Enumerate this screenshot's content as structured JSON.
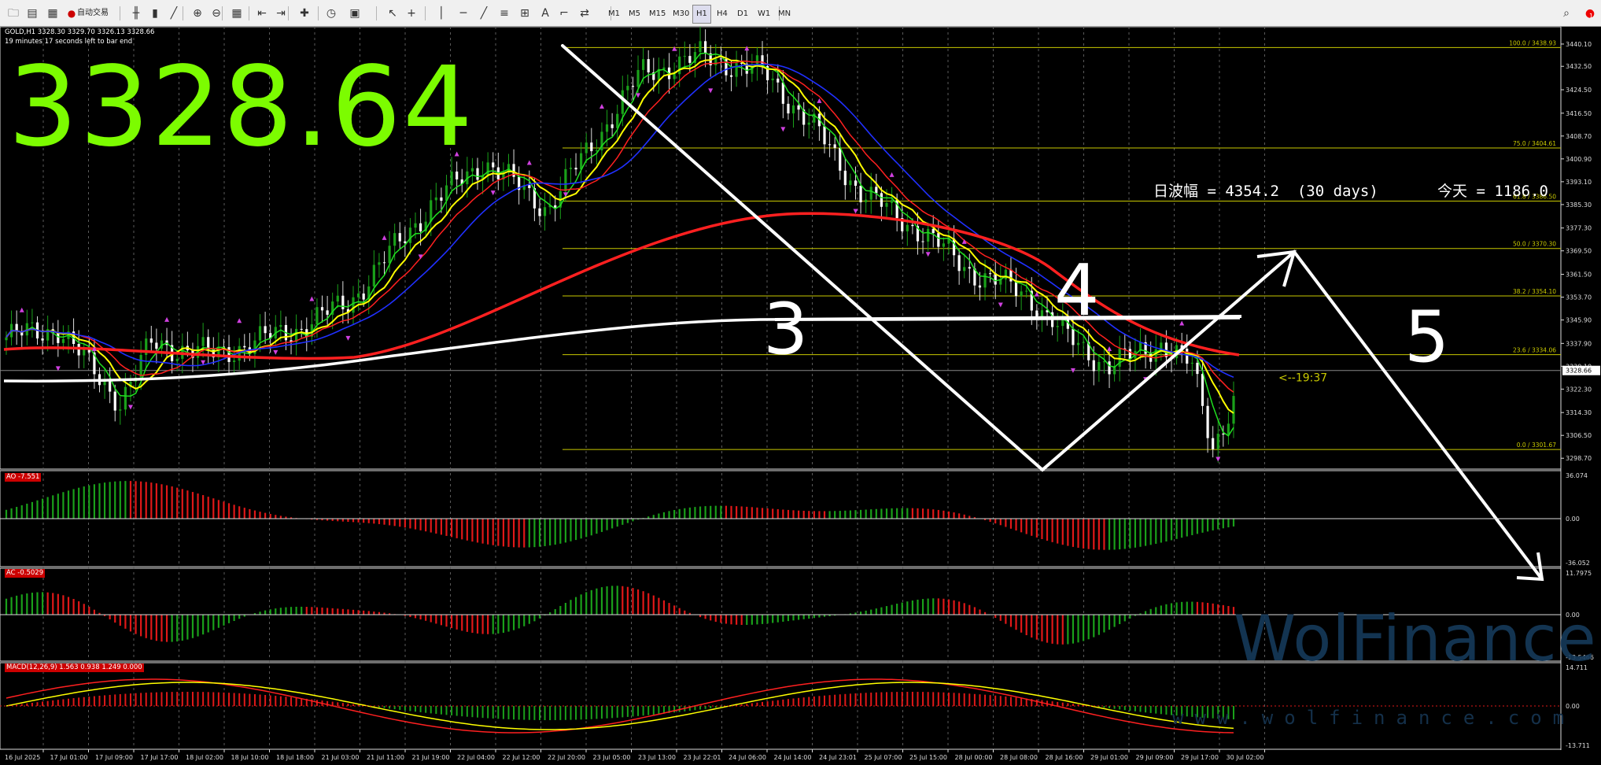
{
  "toolbar": {
    "auto_trading_label": "自动交易",
    "timeframes": [
      "M1",
      "M5",
      "M15",
      "M30",
      "H1",
      "H4",
      "D1",
      "W1",
      "MN"
    ],
    "active_timeframe": "H1",
    "notification_count": "1"
  },
  "chart_header": {
    "symbol_line": "GOLD,H1  3328.30 3329.70 3326.13 3328.66",
    "countdown_line": "19 minutes 17 seconds left to bar end"
  },
  "big_price": "3328.64",
  "daily_range_text": "日波幅 = 4354.2  (30 days)",
  "today_text": "今天 = 1186.0",
  "countdown_marker": "<--19:37",
  "price_axis": {
    "labels": [
      "3440.10",
      "3432.50",
      "3424.50",
      "3416.50",
      "3408.70",
      "3400.90",
      "3393.10",
      "3385.30",
      "3377.30",
      "3369.50",
      "3361.50",
      "3353.70",
      "3345.90",
      "3337.90",
      "3330.10",
      "3322.30",
      "3314.30",
      "3306.50",
      "3298.70"
    ],
    "current_price": "3328.66"
  },
  "fib_labels": [
    {
      "level": 100.0,
      "text": "100.0  /  3438.93"
    },
    {
      "level": 75.0,
      "text": "75.0  /  3404.61"
    },
    {
      "level": 61.8,
      "text": "61.8  /  3386.50"
    },
    {
      "level": 50.0,
      "text": "50.0  /  3370.30"
    },
    {
      "level": 38.2,
      "text": "38.2  /  3354.10"
    },
    {
      "level": 23.6,
      "text": "23.6  /  3334.06"
    },
    {
      "level": 0.0,
      "text": "0.0  /  3301.67"
    }
  ],
  "indicators": {
    "ao": {
      "label": "AO -7.551",
      "top": "36.074",
      "zero": "0.00",
      "bottom": "-36.052"
    },
    "ac": {
      "label": "AC -0.5029",
      "top": "11.7975",
      "zero": "0.00",
      "bottom": "-13.5466"
    },
    "macd": {
      "label": "MACD(12,26,9) 1.563 0.938 1.249 0.000",
      "top": "14.711",
      "zero": "0.00",
      "bottom": "-13.711"
    }
  },
  "time_labels": [
    "16 Jul 2025",
    "17 Jul 01:00",
    "17 Jul 09:00",
    "17 Jul 17:00",
    "18 Jul 02:00",
    "18 Jul 10:00",
    "18 Jul 18:00",
    "21 Jul 03:00",
    "21 Jul 11:00",
    "21 Jul 19:00",
    "22 Jul 04:00",
    "22 Jul 12:00",
    "22 Jul 20:00",
    "23 Jul 05:00",
    "23 Jul 13:00",
    "23 Jul 22:01",
    "24 Jul 06:00",
    "24 Jul 14:00",
    "24 Jul 23:01",
    "25 Jul 07:00",
    "25 Jul 15:00",
    "28 Jul 00:00",
    "28 Jul 08:00",
    "28 Jul 16:00",
    "29 Jul 01:00",
    "29 Jul 09:00",
    "29 Jul 17:00",
    "30 Jul 02:00"
  ],
  "wave_labels": [
    "3",
    "4",
    "5"
  ],
  "watermark": "WolFinance",
  "watermark_url": "www.wolfinance.com",
  "colors": {
    "price_text": "#7cfc00",
    "fib": "#c8c800",
    "ma_red": "#ff2020",
    "ma_blue": "#2030ff",
    "ma_yellow": "#ffff00",
    "ma_green": "#20e020",
    "ma_white": "#ffffff",
    "bull": "#1aa01a",
    "bear": "#e01818",
    "frac": "#d040e0"
  }
}
